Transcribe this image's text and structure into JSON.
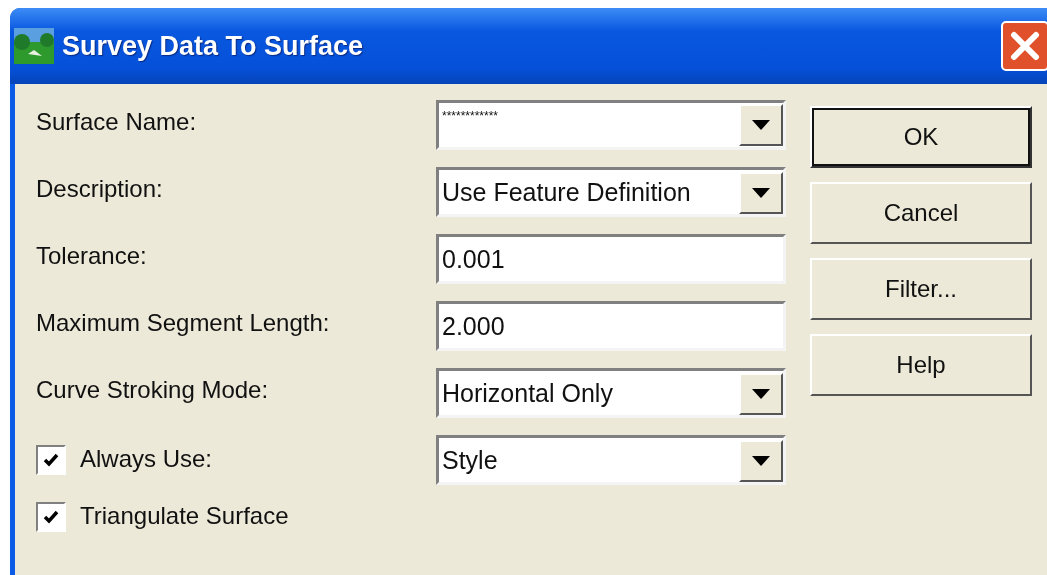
{
  "window": {
    "title": "Survey Data To Surface"
  },
  "rows": [
    {
      "left": {
        "kind": "label",
        "text": "Surface Name:"
      },
      "field": {
        "kind": "combo",
        "value": "************"
      }
    },
    {
      "left": {
        "kind": "label",
        "text": "Description:"
      },
      "field": {
        "kind": "combo",
        "value": "Use Feature Definition"
      }
    },
    {
      "left": {
        "kind": "label",
        "text": "Tolerance:"
      },
      "field": {
        "kind": "text",
        "value": "0.001"
      }
    },
    {
      "left": {
        "kind": "label",
        "text": "Maximum Segment Length:"
      },
      "field": {
        "kind": "text",
        "value": "2.000"
      }
    },
    {
      "left": {
        "kind": "label",
        "text": "Curve Stroking Mode:"
      },
      "field": {
        "kind": "combo",
        "value": "Horizontal Only"
      }
    },
    {
      "left": {
        "kind": "checkbox",
        "text": "Always Use:",
        "checked": true
      },
      "field": {
        "kind": "combo",
        "value": "Style"
      }
    },
    {
      "left": {
        "kind": "checkbox",
        "text": "Triangulate Surface",
        "checked": true
      }
    }
  ],
  "buttons": [
    {
      "label": "OK",
      "default": true
    },
    {
      "label": "Cancel",
      "default": false
    },
    {
      "label": "Filter...",
      "default": false
    },
    {
      "label": "Help",
      "default": false
    }
  ]
}
